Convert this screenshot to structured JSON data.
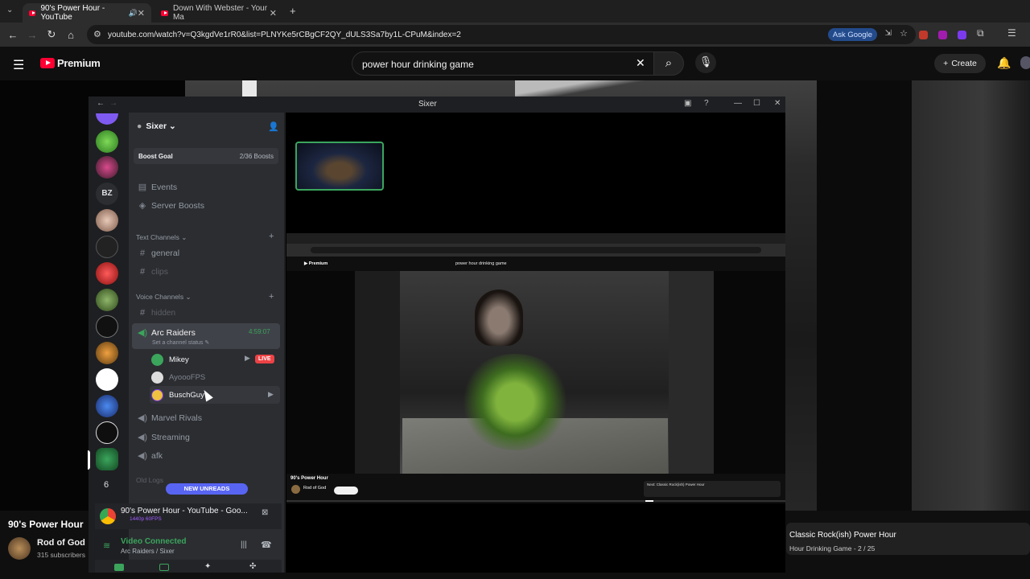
{
  "browser": {
    "tabs": [
      {
        "title": "90's Power Hour - YouTube",
        "active": true
      },
      {
        "title": "Down With Webster - Your Ma",
        "active": false
      }
    ],
    "url": "youtube.com/watch?v=Q3kgdVe1rR0&list=PLNYKe5rCBgCF2QY_dULS3Sa7by1L-CPuM&index=2",
    "ask_google": "Ask Google"
  },
  "youtube": {
    "brand": "Premium",
    "search_value": "power hour drinking game",
    "create_label": "Create",
    "video_title": "90's Power Hour",
    "channel_name": "Rod of God",
    "subscribers": "315 subscribers",
    "next_title": "Classic Rock(ish) Power Hour",
    "next_sub": "Hour Drinking Game - 2 / 25"
  },
  "discord": {
    "window_title": "Sixer",
    "server_name": "Sixer",
    "boost_goal": "Boost Goal",
    "boost_count": "2/36 Boosts",
    "events": "Events",
    "server_boosts": "Server Boosts",
    "text_channels": "Text Channels",
    "text": [
      "general",
      "clips"
    ],
    "voice_channels": "Voice Channels",
    "hidden": "hidden",
    "active_voice": "Arc Raiders",
    "voice_timer": "4:59:07",
    "channel_status": "Set a channel status",
    "users": [
      "Mikey",
      "AyoooFPS",
      "BuschGuy"
    ],
    "live": "LIVE",
    "other_voice": [
      "Marvel Rivals",
      "Streaming",
      "afk"
    ],
    "old_cat": "Old Logs",
    "new_unreads": "NEW UNREADS",
    "activity_title": "90's Power Hour - YouTube - Goo...",
    "activity_sub": "1440p 60FPS",
    "vc_title": "Video Connected",
    "vc_sub": "Arc Raiders / Sixer",
    "guild_bz": "BZ",
    "guild_count": "6"
  },
  "stream": {
    "search": "power hour drinking game",
    "title": "90's Power Hour",
    "channel": "Rod of God",
    "next": "Next: Classic Rock(ish) Power Hour"
  }
}
